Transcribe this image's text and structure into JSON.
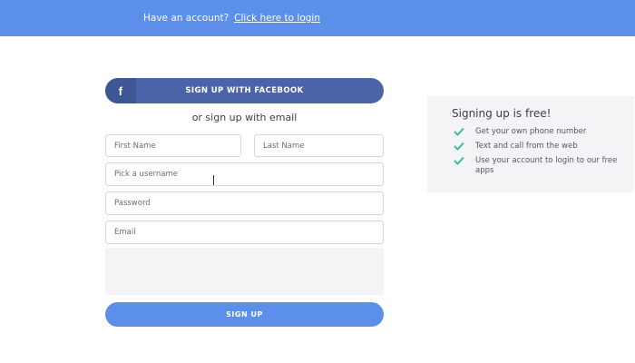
{
  "topbar": {
    "prompt": "Have an account?",
    "login_link": "Click here to login"
  },
  "facebook": {
    "icon_letter": "f",
    "label": "SIGN UP WITH FACEBOOK",
    "color": "#4b63a8"
  },
  "divider_text": "or sign up with email",
  "form": {
    "first_name_placeholder": "First Name",
    "last_name_placeholder": "Last Name",
    "username_placeholder": "Pick a username",
    "password_placeholder": "Password",
    "email_placeholder": "Email",
    "submit_label": "SIGN UP"
  },
  "side_panel": {
    "title": "Signing up is free!",
    "benefits": [
      "Get your own phone number",
      "Text and call from the web",
      "Use your account to login to our free apps"
    ],
    "check_color": "#3bbf9c"
  },
  "colors": {
    "accent": "#5b8fe9"
  }
}
